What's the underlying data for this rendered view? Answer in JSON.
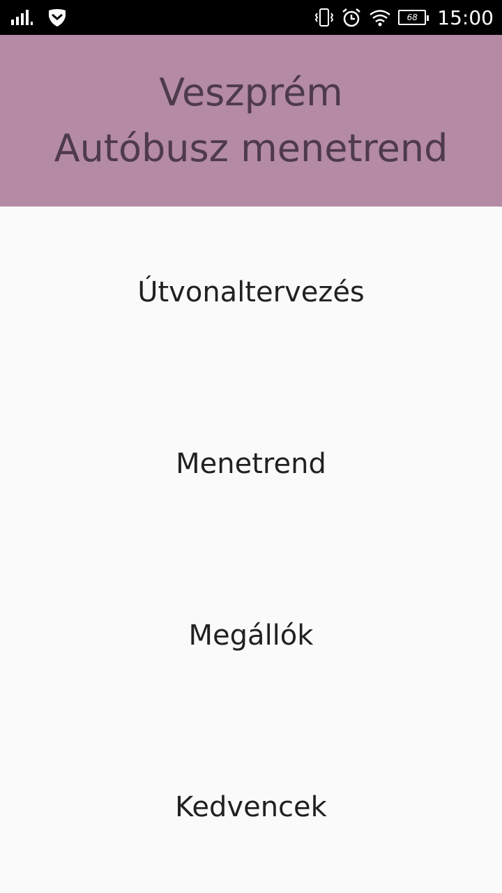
{
  "status_bar": {
    "icons": [
      "signal-icon",
      "shield-icon",
      "vibrate-icon",
      "alarm-icon",
      "wifi-icon",
      "battery-icon"
    ],
    "battery_level": "68",
    "time": "15:00"
  },
  "header": {
    "line1": "Veszprém",
    "line2": "Autóbusz menetrend",
    "background_color": "#b48aa4",
    "text_color": "#4e3a4b"
  },
  "menu": {
    "items": [
      {
        "label": "Útvonaltervezés"
      },
      {
        "label": "Menetrend"
      },
      {
        "label": "Megállók"
      },
      {
        "label": "Kedvencek"
      }
    ]
  }
}
